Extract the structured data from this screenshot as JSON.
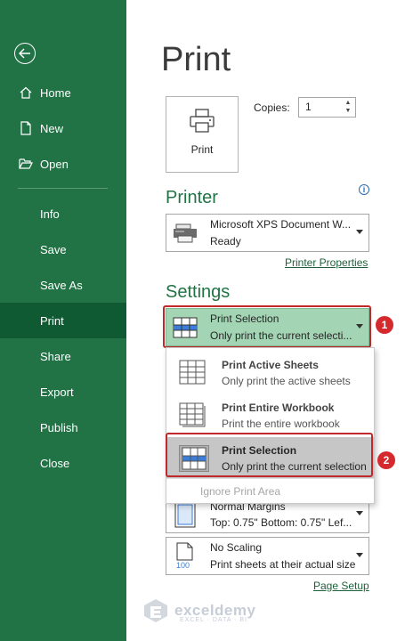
{
  "sidebar": {
    "back_label": "Back",
    "items": [
      {
        "label": "Home"
      },
      {
        "label": "New"
      },
      {
        "label": "Open"
      },
      {
        "label": "Info"
      },
      {
        "label": "Save"
      },
      {
        "label": "Save As"
      },
      {
        "label": "Print"
      },
      {
        "label": "Share"
      },
      {
        "label": "Export"
      },
      {
        "label": "Publish"
      },
      {
        "label": "Close"
      }
    ]
  },
  "main": {
    "title": "Print",
    "print_button_label": "Print",
    "copies_label": "Copies:",
    "copies_value": "1",
    "printer_heading": "Printer",
    "printer": {
      "name": "Microsoft XPS Document W...",
      "status": "Ready"
    },
    "printer_properties_link": "Printer Properties",
    "settings_heading": "Settings",
    "print_what": {
      "title": "Print Selection",
      "subtitle": "Only print the current selecti..."
    },
    "margins": {
      "title": "Normal Margins",
      "subtitle": "Top: 0.75\" Bottom: 0.75\" Lef..."
    },
    "scaling": {
      "title": "No Scaling",
      "subtitle": "Print sheets at their actual size",
      "icon_text": "100"
    },
    "page_setup_link": "Page Setup"
  },
  "menu": {
    "items": [
      {
        "title": "Print Active Sheets",
        "subtitle": "Only print the active sheets"
      },
      {
        "title": "Print Entire Workbook",
        "subtitle": "Print the entire workbook"
      },
      {
        "title": "Print Selection",
        "subtitle": "Only print the current selection"
      }
    ],
    "ignore_print_area": "Ignore Print Area"
  },
  "badges": {
    "first": "1",
    "second": "2"
  },
  "watermark": {
    "name": "exceldemy",
    "tagline": "EXCEL · DATA · BI"
  },
  "colors": {
    "sidebar": "#217346",
    "sidebar_active": "#0f5a33",
    "accent_green": "#217346",
    "highlight": "#a3d4b4",
    "callout_red": "#c0282b"
  }
}
